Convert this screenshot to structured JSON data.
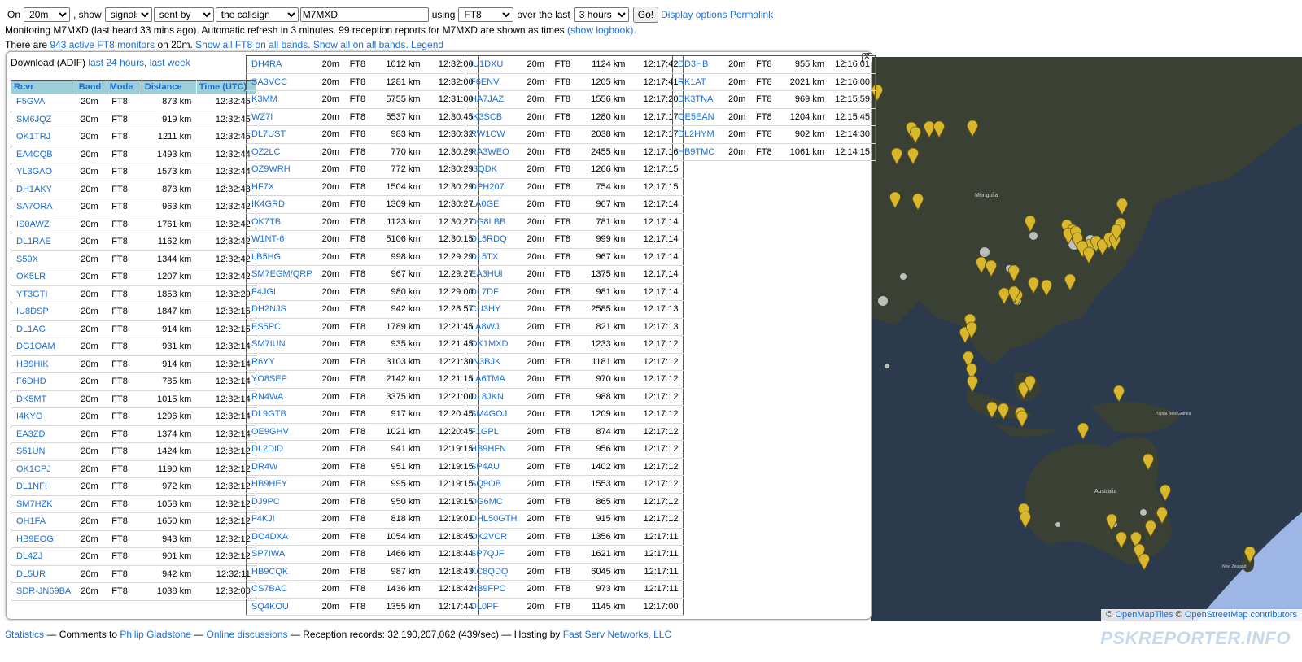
{
  "controls": {
    "on_label": "On",
    "band": "20m",
    "show_label": ", show",
    "show_type": "signals",
    "direction": "sent by",
    "target": "the callsign",
    "callsign": "M7MXD",
    "using_label": "using",
    "mode": "FT8",
    "over_label": "over the last",
    "period": "3 hours",
    "go_label": "Go!",
    "display_options": "Display options",
    "permalink": "Permalink"
  },
  "info": {
    "monitoring": "Monitoring M7MXD (last heard 33 mins ago). Automatic refresh in 3 minutes. 99 reception reports for M7MXD are shown as times",
    "show_logbook": "(show logbook).",
    "there_are": "There are",
    "active_monitors": "943 active FT8 monitors",
    "on_band": "on 20m.",
    "show_all_ft8": "Show all FT8 on all bands.",
    "show_all": "Show all on all bands.",
    "legend": "Legend"
  },
  "download": {
    "label": "Download (ADIF)",
    "last24": "last 24 hours",
    "sep": ",",
    "lastweek": "last week"
  },
  "table_headers": [
    "Rcvr",
    "Band",
    "Mode",
    "Distance",
    "Time (UTC)"
  ],
  "columns": [
    [
      [
        "F5GVA",
        "20m",
        "FT8",
        "873 km",
        "12:32:45"
      ],
      [
        "SM6JQZ",
        "20m",
        "FT8",
        "919 km",
        "12:32:45"
      ],
      [
        "OK1TRJ",
        "20m",
        "FT8",
        "1211 km",
        "12:32:45"
      ],
      [
        "EA4CQB",
        "20m",
        "FT8",
        "1493 km",
        "12:32:44"
      ],
      [
        "YL3GAO",
        "20m",
        "FT8",
        "1573 km",
        "12:32:44"
      ],
      [
        "DH1AKY",
        "20m",
        "FT8",
        "873 km",
        "12:32:43"
      ],
      [
        "SA7ORA",
        "20m",
        "FT8",
        "963 km",
        "12:32:42"
      ],
      [
        "IS0AWZ",
        "20m",
        "FT8",
        "1761 km",
        "12:32:42"
      ],
      [
        "DL1RAE",
        "20m",
        "FT8",
        "1162 km",
        "12:32:42"
      ],
      [
        "S59X",
        "20m",
        "FT8",
        "1344 km",
        "12:32:42"
      ],
      [
        "OK5LR",
        "20m",
        "FT8",
        "1207 km",
        "12:32:42"
      ],
      [
        "YT3GTI",
        "20m",
        "FT8",
        "1853 km",
        "12:32:29"
      ],
      [
        "IU8DSP",
        "20m",
        "FT8",
        "1847 km",
        "12:32:15"
      ],
      [
        "DL1AG",
        "20m",
        "FT8",
        "914 km",
        "12:32:15"
      ],
      [
        "DG1OAM",
        "20m",
        "FT8",
        "931 km",
        "12:32:14"
      ],
      [
        "HB9HIK",
        "20m",
        "FT8",
        "914 km",
        "12:32:14"
      ],
      [
        "F6DHD",
        "20m",
        "FT8",
        "785 km",
        "12:32:14"
      ],
      [
        "DK5MT",
        "20m",
        "FT8",
        "1015 km",
        "12:32:14"
      ],
      [
        "I4KYO",
        "20m",
        "FT8",
        "1296 km",
        "12:32:14"
      ],
      [
        "EA3ZD",
        "20m",
        "FT8",
        "1374 km",
        "12:32:14"
      ],
      [
        "S51UN",
        "20m",
        "FT8",
        "1424 km",
        "12:32:12"
      ],
      [
        "OK1CPJ",
        "20m",
        "FT8",
        "1190 km",
        "12:32:12"
      ],
      [
        "DL1NFI",
        "20m",
        "FT8",
        "972 km",
        "12:32:12"
      ],
      [
        "SM7HZK",
        "20m",
        "FT8",
        "1058 km",
        "12:32:12"
      ],
      [
        "OH1FA",
        "20m",
        "FT8",
        "1650 km",
        "12:32:12"
      ],
      [
        "HB9EOG",
        "20m",
        "FT8",
        "943 km",
        "12:32:12"
      ],
      [
        "DL4ZJ",
        "20m",
        "FT8",
        "901 km",
        "12:32:12"
      ],
      [
        "DL5UR",
        "20m",
        "FT8",
        "942 km",
        "12:32:11"
      ],
      [
        "SDR-JN69BA",
        "20m",
        "FT8",
        "1038 km",
        "12:32:00"
      ]
    ],
    [
      [
        "DH4RA",
        "20m",
        "FT8",
        "1012 km",
        "12:32:00"
      ],
      [
        "SA3VCC",
        "20m",
        "FT8",
        "1281 km",
        "12:32:00"
      ],
      [
        "K3MM",
        "20m",
        "FT8",
        "5755 km",
        "12:31:00"
      ],
      [
        "WZ7I",
        "20m",
        "FT8",
        "5537 km",
        "12:30:45"
      ],
      [
        "DL7UST",
        "20m",
        "FT8",
        "983 km",
        "12:30:32"
      ],
      [
        "OZ2LC",
        "20m",
        "FT8",
        "770 km",
        "12:30:29"
      ],
      [
        "OZ9WRH",
        "20m",
        "FT8",
        "772 km",
        "12:30:29"
      ],
      [
        "HF7X",
        "20m",
        "FT8",
        "1504 km",
        "12:30:29"
      ],
      [
        "IK4GRD",
        "20m",
        "FT8",
        "1309 km",
        "12:30:27"
      ],
      [
        "OK7TB",
        "20m",
        "FT8",
        "1123 km",
        "12:30:27"
      ],
      [
        "W1NT-6",
        "20m",
        "FT8",
        "5106 km",
        "12:30:15"
      ],
      [
        "LB5HG",
        "20m",
        "FT8",
        "998 km",
        "12:29:29"
      ],
      [
        "SM7EGM/QRP",
        "20m",
        "FT8",
        "967 km",
        "12:29:27"
      ],
      [
        "F4JGI",
        "20m",
        "FT8",
        "980 km",
        "12:29:00"
      ],
      [
        "DH2NJS",
        "20m",
        "FT8",
        "942 km",
        "12:28:57"
      ],
      [
        "ES5PC",
        "20m",
        "FT8",
        "1789 km",
        "12:21:45"
      ],
      [
        "SM7IUN",
        "20m",
        "FT8",
        "935 km",
        "12:21:45"
      ],
      [
        "R6YY",
        "20m",
        "FT8",
        "3103 km",
        "12:21:30"
      ],
      [
        "YO8SEP",
        "20m",
        "FT8",
        "2142 km",
        "12:21:15"
      ],
      [
        "RN4WA",
        "20m",
        "FT8",
        "3375 km",
        "12:21:00"
      ],
      [
        "DL9GTB",
        "20m",
        "FT8",
        "917 km",
        "12:20:45"
      ],
      [
        "OE9GHV",
        "20m",
        "FT8",
        "1021 km",
        "12:20:45"
      ],
      [
        "DL2DID",
        "20m",
        "FT8",
        "941 km",
        "12:19:15"
      ],
      [
        "DR4W",
        "20m",
        "FT8",
        "951 km",
        "12:19:15"
      ],
      [
        "HB9HEY",
        "20m",
        "FT8",
        "995 km",
        "12:19:15"
      ],
      [
        "DJ9PC",
        "20m",
        "FT8",
        "950 km",
        "12:19:15"
      ],
      [
        "F4KJI",
        "20m",
        "FT8",
        "818 km",
        "12:19:01"
      ],
      [
        "DO4DXA",
        "20m",
        "FT8",
        "1054 km",
        "12:18:45"
      ],
      [
        "SP7IWA",
        "20m",
        "FT8",
        "1466 km",
        "12:18:44"
      ],
      [
        "HB9CQK",
        "20m",
        "FT8",
        "987 km",
        "12:18:43"
      ],
      [
        "CS7BAC",
        "20m",
        "FT8",
        "1436 km",
        "12:18:42"
      ],
      [
        "SQ4KOU",
        "20m",
        "FT8",
        "1355 km",
        "12:17:44"
      ]
    ],
    [
      [
        "IU1DXU",
        "20m",
        "FT8",
        "1124 km",
        "12:17:42"
      ],
      [
        "F6ENV",
        "20m",
        "FT8",
        "1205 km",
        "12:17:41"
      ],
      [
        "HA7JAZ",
        "20m",
        "FT8",
        "1556 km",
        "12:17:20"
      ],
      [
        "IK3SCB",
        "20m",
        "FT8",
        "1280 km",
        "12:17:17"
      ],
      [
        "RW1CW",
        "20m",
        "FT8",
        "2038 km",
        "12:17:17"
      ],
      [
        "RA3WEO",
        "20m",
        "FT8",
        "2455 km",
        "12:17:16"
      ],
      [
        "I3QDK",
        "20m",
        "FT8",
        "1266 km",
        "12:17:15"
      ],
      [
        "DPH207",
        "20m",
        "FT8",
        "754 km",
        "12:17:15"
      ],
      [
        "LA0GE",
        "20m",
        "FT8",
        "967 km",
        "12:17:14"
      ],
      [
        "DG8LBB",
        "20m",
        "FT8",
        "781 km",
        "12:17:14"
      ],
      [
        "DL5RDQ",
        "20m",
        "FT8",
        "999 km",
        "12:17:14"
      ],
      [
        "DL5TX",
        "20m",
        "FT8",
        "967 km",
        "12:17:14"
      ],
      [
        "EA3HUI",
        "20m",
        "FT8",
        "1375 km",
        "12:17:14"
      ],
      [
        "DL7DF",
        "20m",
        "FT8",
        "981 km",
        "12:17:14"
      ],
      [
        "CU3HY",
        "20m",
        "FT8",
        "2585 km",
        "12:17:13"
      ],
      [
        "LA8WJ",
        "20m",
        "FT8",
        "821 km",
        "12:17:13"
      ],
      [
        "OK1MXD",
        "20m",
        "FT8",
        "1233 km",
        "12:17:12"
      ],
      [
        "IN3BJK",
        "20m",
        "FT8",
        "1181 km",
        "12:17:12"
      ],
      [
        "LA6TMA",
        "20m",
        "FT8",
        "970 km",
        "12:17:12"
      ],
      [
        "DL8JKN",
        "20m",
        "FT8",
        "988 km",
        "12:17:12"
      ],
      [
        "SM4GOJ",
        "20m",
        "FT8",
        "1209 km",
        "12:17:12"
      ],
      [
        "F1GPL",
        "20m",
        "FT8",
        "874 km",
        "12:17:12"
      ],
      [
        "HB9HFN",
        "20m",
        "FT8",
        "956 km",
        "12:17:12"
      ],
      [
        "SP4AU",
        "20m",
        "FT8",
        "1402 km",
        "12:17:12"
      ],
      [
        "SQ9OB",
        "20m",
        "FT8",
        "1553 km",
        "12:17:12"
      ],
      [
        "DG6MC",
        "20m",
        "FT8",
        "865 km",
        "12:17:12"
      ],
      [
        "DHL50GTH",
        "20m",
        "FT8",
        "915 km",
        "12:17:12"
      ],
      [
        "OK2VCR",
        "20m",
        "FT8",
        "1356 km",
        "12:17:11"
      ],
      [
        "SP7QJF",
        "20m",
        "FT8",
        "1621 km",
        "12:17:11"
      ],
      [
        "KC8QDQ",
        "20m",
        "FT8",
        "6045 km",
        "12:17:11"
      ],
      [
        "HB9FPC",
        "20m",
        "FT8",
        "973 km",
        "12:17:11"
      ],
      [
        "DL0PF",
        "20m",
        "FT8",
        "1145 km",
        "12:17:00"
      ]
    ],
    [
      [
        "DD3HB",
        "20m",
        "FT8",
        "955 km",
        "12:16:01"
      ],
      [
        "RK1AT",
        "20m",
        "FT8",
        "2021 km",
        "12:16:00"
      ],
      [
        "DK3TNA",
        "20m",
        "FT8",
        "969 km",
        "12:15:59"
      ],
      [
        "OE5EAN",
        "20m",
        "FT8",
        "1204 km",
        "12:15:45"
      ],
      [
        "DL2HYM",
        "20m",
        "FT8",
        "902 km",
        "12:14:30"
      ],
      [
        "HB9TMC",
        "20m",
        "FT8",
        "1061 km",
        "12:14:15"
      ]
    ]
  ],
  "map": {
    "attribution_prefix": "©",
    "openmaptiles": "OpenMapTiles",
    "osm": "OpenStreetMap contributors",
    "labels": [
      "Mongolia",
      "Australia",
      "Papua New Guinea",
      "New Zealand"
    ],
    "marker_color": "#d8b72e"
  },
  "footer": {
    "statistics": "Statistics",
    "comments_prefix": "— Comments to",
    "author": "Philip Gladstone",
    "sep": "—",
    "discussions": "Online discussions",
    "records": "— Reception records: 32,190,207,062 (439/sec) — Hosting by",
    "host": "Fast Serv Networks, LLC"
  },
  "brand": "PSKREPORTER.INFO"
}
